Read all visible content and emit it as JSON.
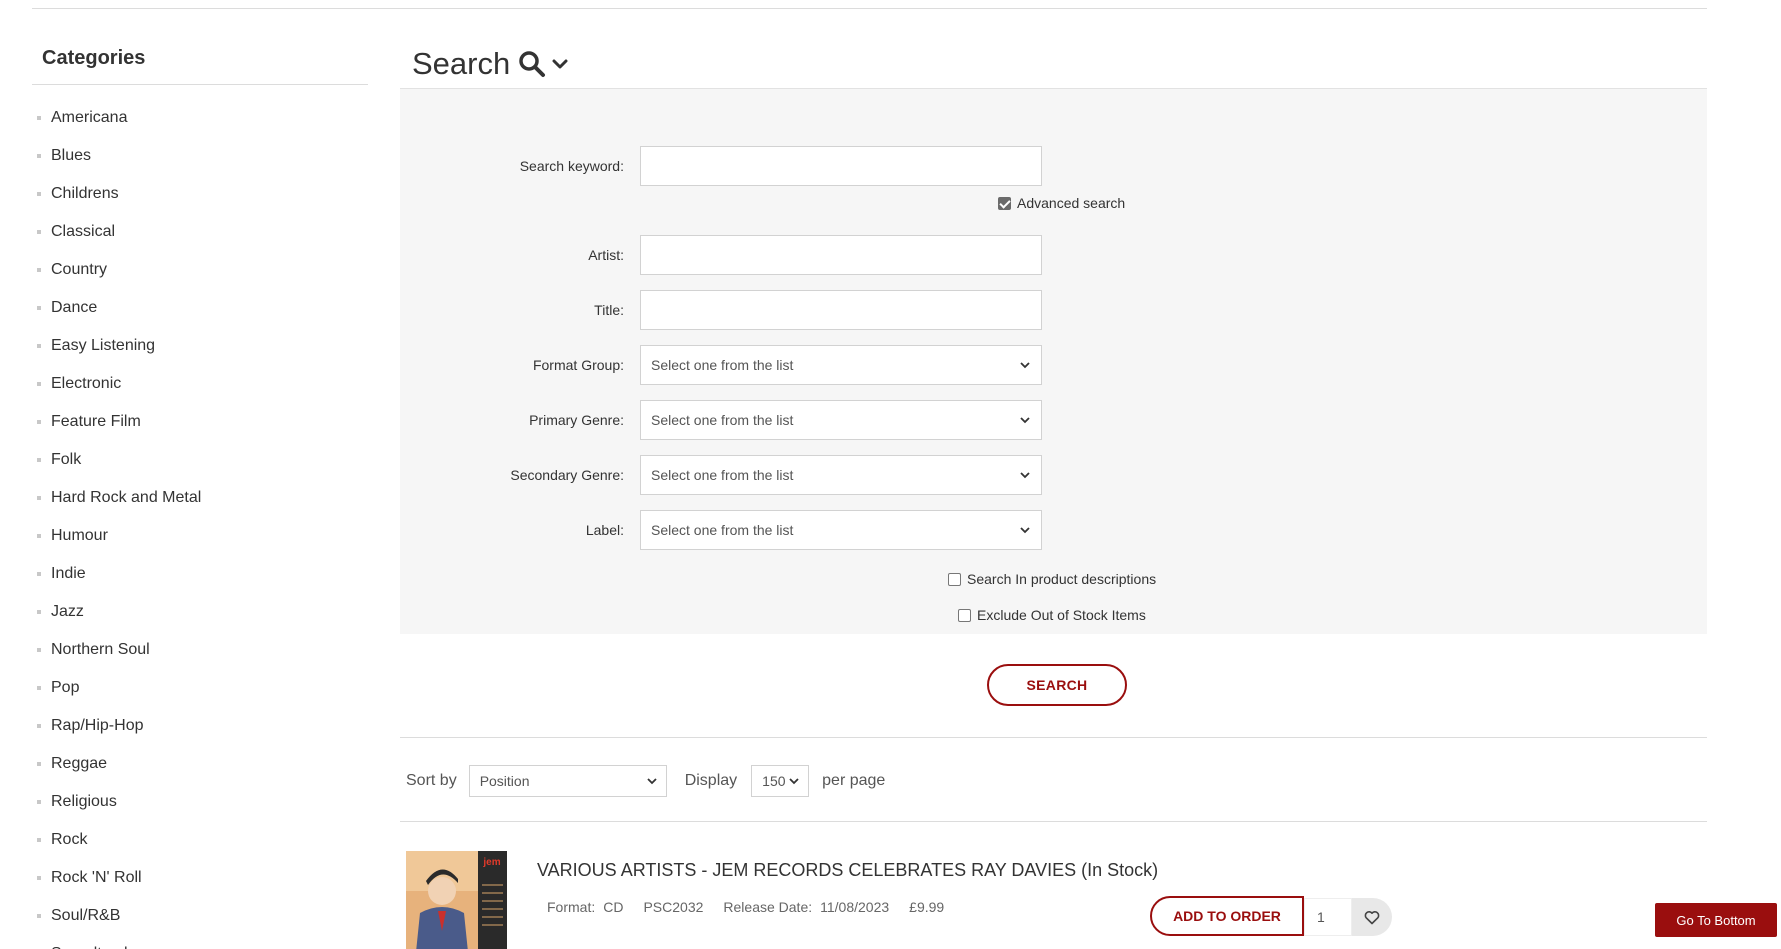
{
  "sidebar": {
    "title": "Categories",
    "items": [
      {
        "label": "Americana"
      },
      {
        "label": "Blues"
      },
      {
        "label": "Childrens"
      },
      {
        "label": "Classical"
      },
      {
        "label": "Country"
      },
      {
        "label": "Dance"
      },
      {
        "label": "Easy Listening"
      },
      {
        "label": "Electronic"
      },
      {
        "label": "Feature Film"
      },
      {
        "label": "Folk"
      },
      {
        "label": "Hard Rock and Metal"
      },
      {
        "label": "Humour"
      },
      {
        "label": "Indie"
      },
      {
        "label": "Jazz"
      },
      {
        "label": "Northern Soul"
      },
      {
        "label": "Pop"
      },
      {
        "label": "Rap/Hip-Hop"
      },
      {
        "label": "Reggae"
      },
      {
        "label": "Religious"
      },
      {
        "label": "Rock"
      },
      {
        "label": "Rock 'N' Roll"
      },
      {
        "label": "Soul/R&B"
      },
      {
        "label": "Soundtrack"
      }
    ]
  },
  "search": {
    "title": "Search",
    "keyword_label": "Search keyword:",
    "keyword_value": "",
    "advanced_label": "Advanced search",
    "advanced_checked": true,
    "artist_label": "Artist:",
    "artist_value": "",
    "title_label": "Title:",
    "title_value": "",
    "format_group_label": "Format Group:",
    "format_group_value": "Select one from the list",
    "primary_genre_label": "Primary Genre:",
    "primary_genre_value": "Select one from the list",
    "secondary_genre_label": "Secondary Genre:",
    "secondary_genre_value": "Select one from the list",
    "label_label": "Label:",
    "label_value": "Select one from the list",
    "search_descriptions_label": "Search In product descriptions",
    "exclude_oos_label": "Exclude Out of Stock Items",
    "button_label": "SEARCH"
  },
  "sort": {
    "sort_by_label": "Sort by",
    "sort_value": "Position",
    "display_label": "Display",
    "display_value": "150",
    "per_page_label": "per page"
  },
  "product": {
    "title": "VARIOUS ARTISTS - JEM RECORDS CELEBRATES RAY DAVIES (In Stock)",
    "format_label": "Format:",
    "format_value": "CD",
    "catalog": "PSC2032",
    "release_label": "Release Date:",
    "release_value": "11/08/2023",
    "price": "£9.99",
    "add_label": "ADD TO ORDER",
    "qty": "1",
    "cover_logo": "jem"
  },
  "goto_bottom_label": "Go To Bottom",
  "colors": {
    "accent": "#9a0e0e",
    "panel": "#f6f6f6"
  }
}
